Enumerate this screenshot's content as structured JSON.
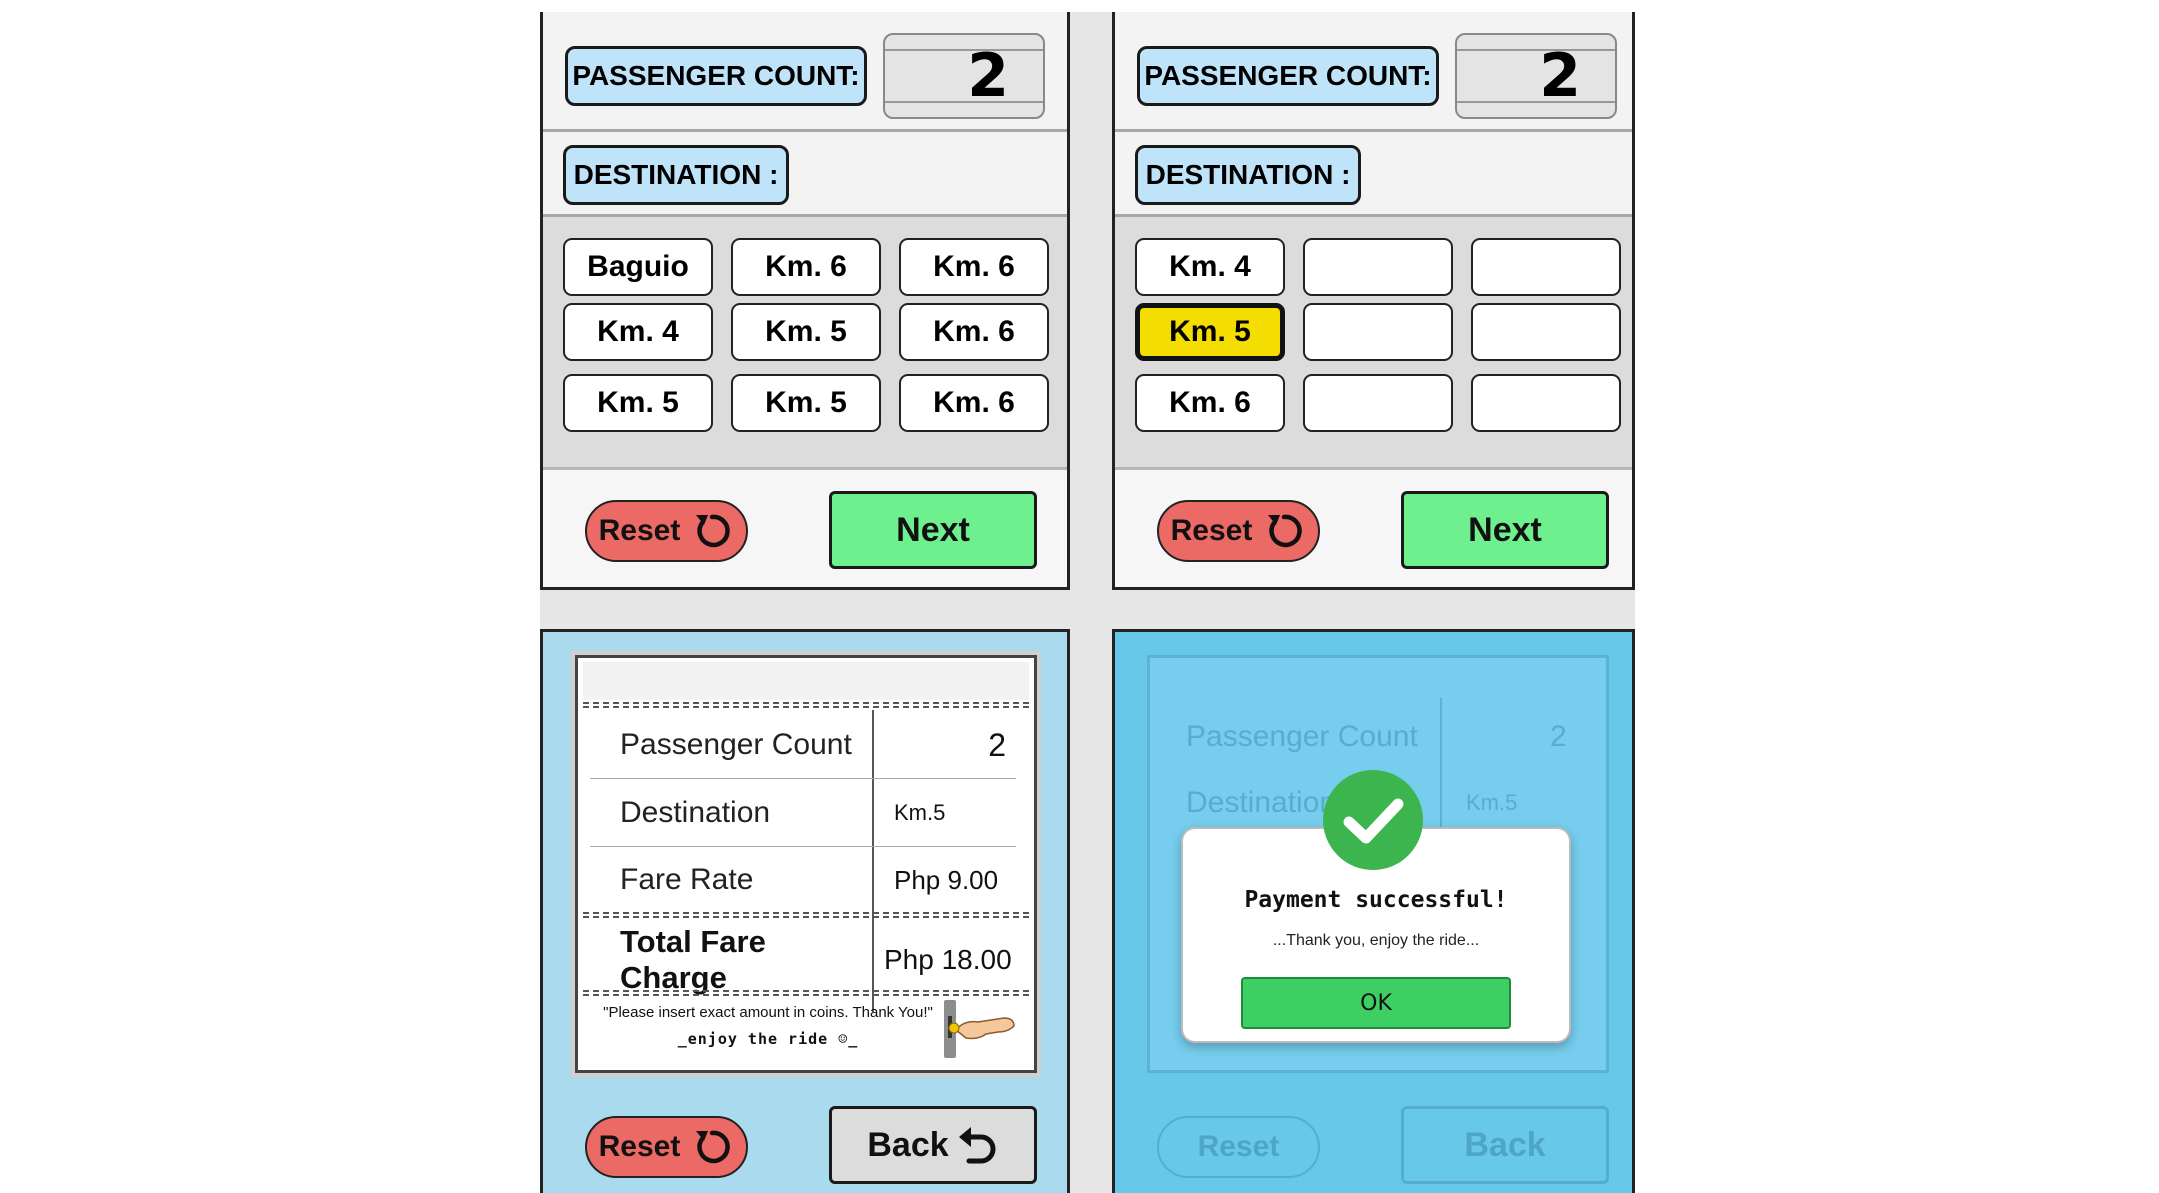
{
  "screens": {
    "passenger_label": "PASSENGER COUNT:",
    "destination_label": "DESTINATION :",
    "passenger_count": "2",
    "reset_label": "Reset",
    "next_label": "Next",
    "back_label": "Back"
  },
  "screen1": {
    "destinations": [
      "Baguio",
      "Km. 6",
      "Km. 6",
      "Km. 4",
      "Km. 5",
      "Km. 6",
      "Km. 5",
      "Km. 5",
      "Km. 6"
    ]
  },
  "screen2": {
    "destinations": [
      "Km. 4",
      "",
      "",
      "Km. 5",
      "",
      "",
      "Km. 6",
      "",
      ""
    ],
    "selected": "Km. 5"
  },
  "receipt": {
    "rows": [
      {
        "label": "Passenger Count",
        "value": "2"
      },
      {
        "label": "Destination",
        "value": "Km.5"
      },
      {
        "label": "Fare Rate",
        "value": "Php 9.00"
      }
    ],
    "total_label": "Total Fare Charge",
    "total_value": "Php 18.00",
    "note": "\"Please insert exact amount in coins. Thank You!\"",
    "tagline": "_enjoy the ride ☺_"
  },
  "modal": {
    "title": "Payment successful!",
    "message": "...Thank you, enjoy the ride...",
    "ok_label": "OK"
  },
  "colors": {
    "reset": "#ec6a66",
    "next": "#6ff08f",
    "selected": "#f4dd00",
    "label_pill": "#bfe3f8",
    "bottom_bg": "#a9daee",
    "success": "#3cb54e"
  }
}
